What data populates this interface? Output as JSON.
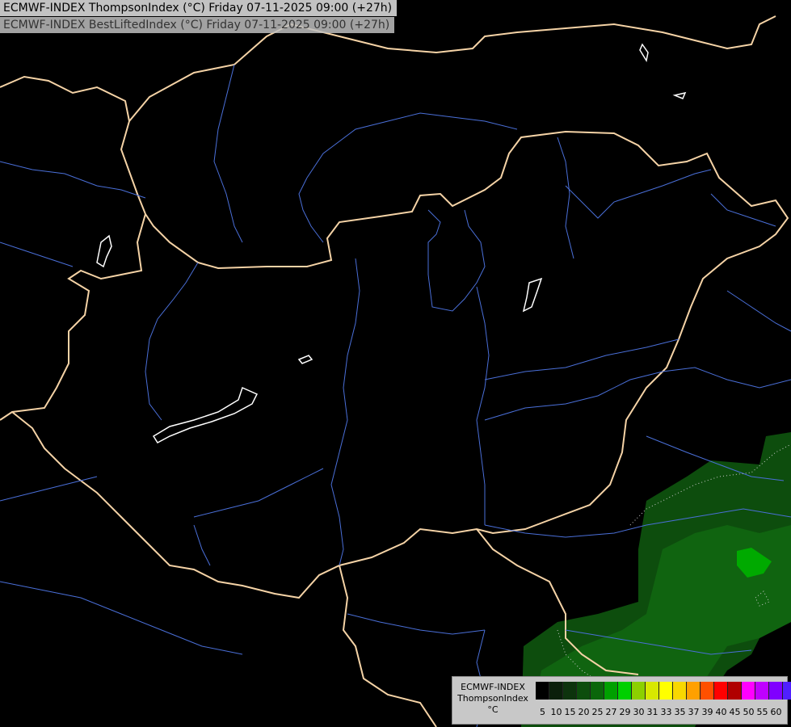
{
  "header": {
    "title_primary": "ECMWF-INDEX ThompsonIndex (°C) Friday 07-11-2025 09:00 (+27h)",
    "title_secondary": "ECMWF-INDEX BestLiftedIndex (°C) Friday 07-11-2025 09:00 (+27h)"
  },
  "colors": {
    "background": "#000000",
    "border": "#f5d3a6",
    "river": "#4a6fd8",
    "lake": "#ffffff",
    "index_low": "#0d4d0d",
    "index_mid": "#107a10",
    "index_high": "#00aa00"
  },
  "legend": {
    "label_lines": [
      "ECMWF-INDEX",
      "ThompsonIndex",
      "°C"
    ],
    "colors": [
      "#000000",
      "#0a1f0a",
      "#0d330d",
      "#0d4d0d",
      "#0b660b",
      "#00a000",
      "#00d000",
      "#8cd000",
      "#d8e800",
      "#ffff00",
      "#f8d800",
      "#ffa000",
      "#ff5000",
      "#ff0000",
      "#b00000",
      "#ff00ff",
      "#c000ff",
      "#8000ff",
      "#5020ff",
      "#0000ff"
    ],
    "ticks": [
      "5",
      "10",
      "15",
      "20",
      "25",
      "27",
      "29",
      "30",
      "31",
      "33",
      "35",
      "37",
      "39",
      "40",
      "45",
      "50",
      "55",
      "60"
    ]
  }
}
